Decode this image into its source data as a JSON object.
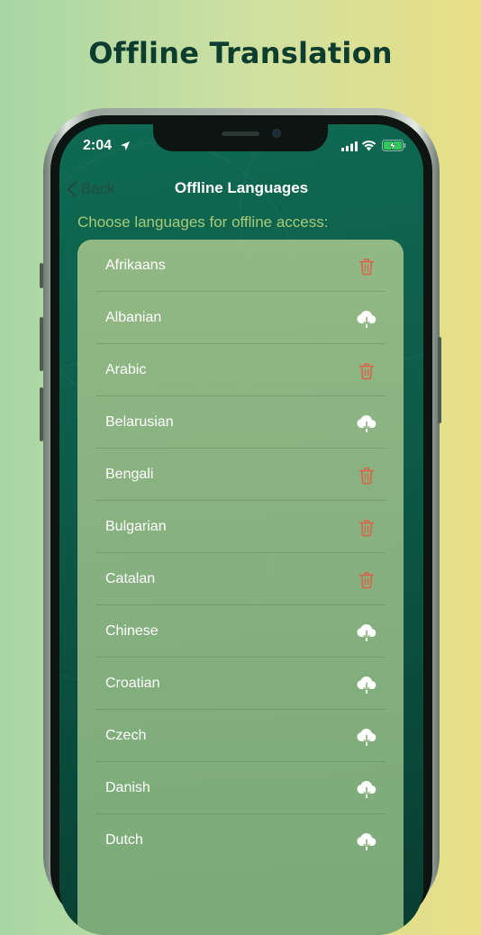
{
  "headline": "Offline Translation",
  "status_bar": {
    "time": "2:04",
    "icons": [
      "location-arrow-icon",
      "cellular-signal-icon",
      "wifi-icon",
      "battery-charging-icon"
    ]
  },
  "nav": {
    "back_label": "Back",
    "title": "Offline Languages"
  },
  "subtitle": "Choose languages for offline access:",
  "colors": {
    "delete": "#d9644a",
    "download": "#ffffff",
    "subtitle": "#a8c97a",
    "headline": "#0c3d2e"
  },
  "languages": [
    {
      "label": "Afrikaans",
      "action": "delete",
      "icon": "trash-icon"
    },
    {
      "label": "Albanian",
      "action": "download",
      "icon": "cloud-download-icon"
    },
    {
      "label": "Arabic",
      "action": "delete",
      "icon": "trash-icon"
    },
    {
      "label": "Belarusian",
      "action": "download",
      "icon": "cloud-download-icon"
    },
    {
      "label": "Bengali",
      "action": "delete",
      "icon": "trash-icon"
    },
    {
      "label": "Bulgarian",
      "action": "delete",
      "icon": "trash-icon"
    },
    {
      "label": "Catalan",
      "action": "delete",
      "icon": "trash-icon"
    },
    {
      "label": "Chinese",
      "action": "download",
      "icon": "cloud-download-icon"
    },
    {
      "label": "Croatian",
      "action": "download",
      "icon": "cloud-download-icon"
    },
    {
      "label": "Czech",
      "action": "download",
      "icon": "cloud-download-icon"
    },
    {
      "label": "Danish",
      "action": "download",
      "icon": "cloud-download-icon"
    },
    {
      "label": "Dutch",
      "action": "download",
      "icon": "cloud-download-icon"
    }
  ]
}
